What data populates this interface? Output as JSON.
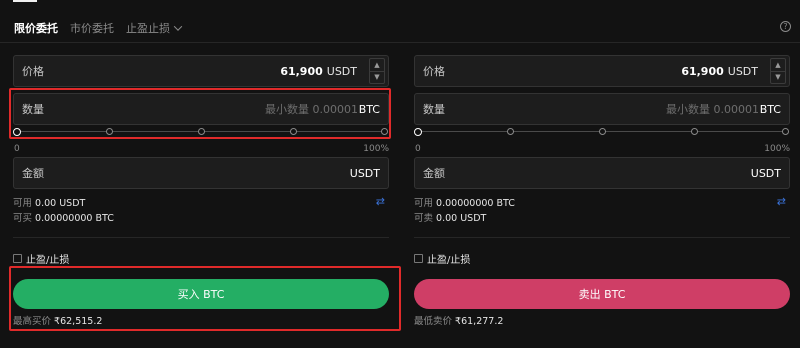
{
  "tabs": [
    {
      "label": "限价委托",
      "active": true
    },
    {
      "label": "市价委托",
      "active": false
    },
    {
      "label": "止盈止损",
      "active": false
    }
  ],
  "help_icon": "?",
  "buy": {
    "price_label": "价格",
    "price_value": "61,900",
    "price_unit": "USDT",
    "qty_label": "数量",
    "qty_placeholder": "最小数量 0.00001",
    "qty_unit": "BTC",
    "slider_min": "0",
    "slider_max": "100%",
    "slider_value": 0,
    "amount_label": "金额",
    "amount_unit": "USDT",
    "available_label": "可用",
    "available_value": "0.00 USDT",
    "can_trade_label": "可买",
    "can_trade_value": "0.00000000 BTC",
    "tpsl_label": "止盈/止损",
    "button_label": "买入 BTC",
    "best_label": "最高买价",
    "best_value": "₹62,515.2"
  },
  "sell": {
    "price_label": "价格",
    "price_value": "61,900",
    "price_unit": "USDT",
    "qty_label": "数量",
    "qty_placeholder": "最小数量 0.00001",
    "qty_unit": "BTC",
    "slider_min": "0",
    "slider_max": "100%",
    "slider_value": 0,
    "amount_label": "金额",
    "amount_unit": "USDT",
    "available_label": "可用",
    "available_value": "0.00000000 BTC",
    "can_trade_label": "可卖",
    "can_trade_value": "0.00 USDT",
    "tpsl_label": "止盈/止损",
    "button_label": "卖出 BTC",
    "best_label": "最低卖价",
    "best_value": "₹61,277.2"
  },
  "colors": {
    "buy": "#24ae64",
    "sell": "#cf3e66",
    "highlight": "#e02a2a",
    "swap_icon": "#3a72d8"
  },
  "icons": {
    "swap": "⇄",
    "stepper_up": "▲",
    "stepper_down": "▼"
  }
}
